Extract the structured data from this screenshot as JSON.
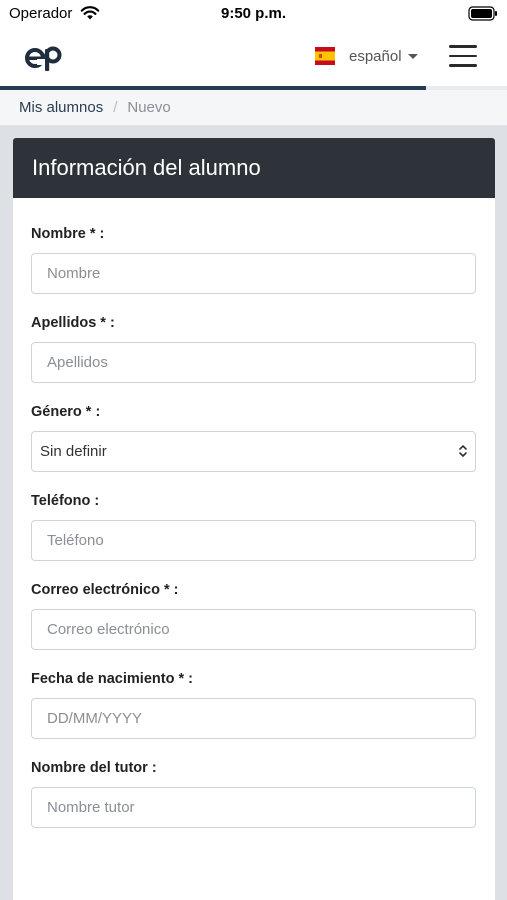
{
  "status_bar": {
    "carrier": "Operador",
    "time": "9:50 p.m."
  },
  "navbar": {
    "logo_text": "eP",
    "language": "español",
    "progress": 0.84
  },
  "breadcrumb": {
    "items": [
      "Mis alumnos",
      "Nuevo"
    ],
    "separator": "/"
  },
  "card": {
    "title": "Información del alumno",
    "fields": [
      {
        "label": "Nombre * :",
        "placeholder": "Nombre"
      },
      {
        "label": "Apellidos * :",
        "placeholder": "Apellidos"
      },
      {
        "label": "Género * :",
        "selected": "Sin definir"
      },
      {
        "label": "Teléfono :",
        "placeholder": "Teléfono"
      },
      {
        "label": "Correo electrónico * :",
        "placeholder": "Correo electrónico"
      },
      {
        "label": "Fecha de nacimiento * :",
        "placeholder": "DD/MM/YYYY"
      },
      {
        "label": "Nombre del tutor :",
        "placeholder": "Nombre tutor"
      }
    ]
  },
  "colors": {
    "header_bg": "#2e3339",
    "accent": "#243a55",
    "page_bg": "#dde1e6"
  }
}
